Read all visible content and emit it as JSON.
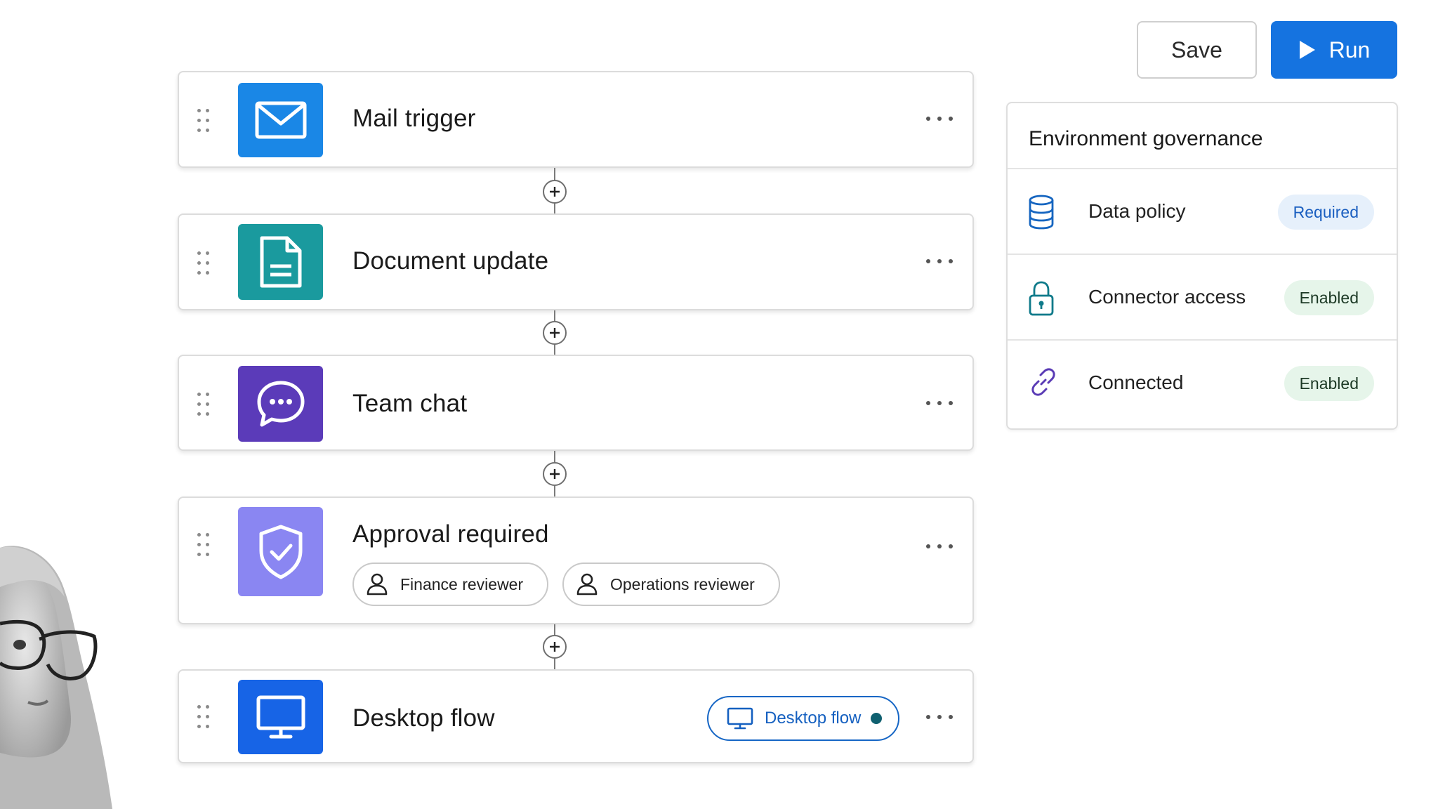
{
  "toolbar": {
    "save_label": "Save",
    "run_label": "Run"
  },
  "flow": {
    "steps": [
      {
        "title": "Mail trigger",
        "icon": "mail-icon",
        "color": "#1a87e6"
      },
      {
        "title": "Document update",
        "icon": "document-icon",
        "color": "#1a9a9e"
      },
      {
        "title": "Team chat",
        "icon": "chat-icon",
        "color": "#5b3bb9"
      },
      {
        "title": "Approval required",
        "icon": "shield-check-icon",
        "color": "#8a86f2",
        "reviewers": [
          "Finance reviewer",
          "Operations reviewer"
        ]
      },
      {
        "title": "Desktop flow",
        "icon": "monitor-icon",
        "color": "#1764e6",
        "badge": "Desktop flow"
      }
    ]
  },
  "governance": {
    "title": "Environment governance",
    "rows": [
      {
        "label": "Data policy",
        "status": "Required",
        "icon": "database-icon"
      },
      {
        "label": "Connector access",
        "status": "Enabled",
        "icon": "lock-icon"
      },
      {
        "label": "Connected",
        "status": "Enabled",
        "icon": "link-icon"
      }
    ]
  },
  "colors": {
    "accent": "#1573e0",
    "required_badge": "#e6f0fb",
    "enabled_badge": "#e6f5ea"
  }
}
